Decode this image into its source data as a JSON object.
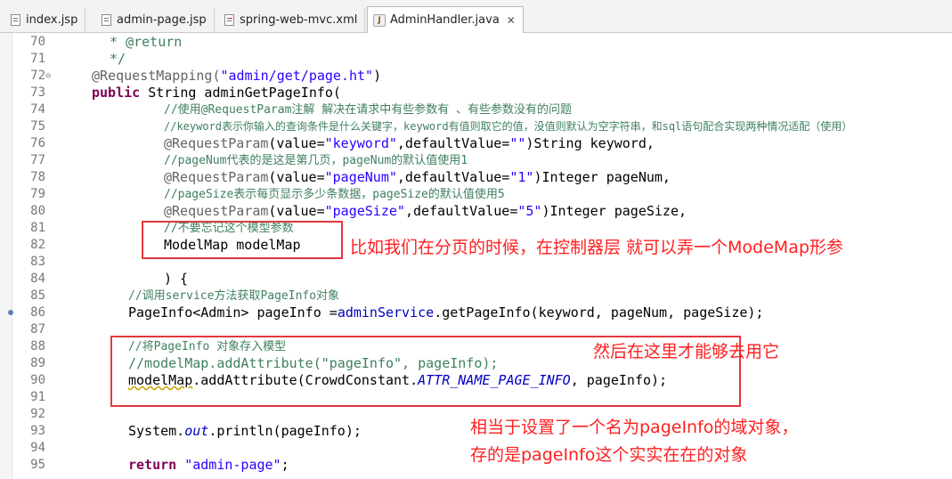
{
  "tabs": [
    {
      "name": "tab-index-jsp",
      "label": "index.jsp",
      "icon": "jsp-file-icon"
    },
    {
      "name": "tab-admin-page-jsp",
      "label": "admin-page.jsp",
      "icon": "jsp-file-icon"
    },
    {
      "name": "tab-spring-web-mvc-xml",
      "label": "spring-web-mvc.xml",
      "icon": "xml-file-icon"
    },
    {
      "name": "tab-admin-handler-java",
      "label": "AdminHandler.java",
      "icon": "java-file-icon",
      "active": true
    }
  ],
  "tab_close": "✕",
  "lines": {
    "l70": {
      "num": "70",
      "text": " * @return"
    },
    "l71": {
      "num": "71",
      "text": " */"
    },
    "l72": {
      "num": "72",
      "fold": "⊖",
      "ann": "@RequestMapping(",
      "str": "\"admin/get/page.ht\"",
      "end": ")"
    },
    "l73": {
      "num": "73",
      "k1": "public",
      "rest": " String adminGetPageInfo("
    },
    "l74": {
      "num": "74",
      "text": "//使用@RequestParam注解 解决在请求中有些参数有 、有些参数没有的问题"
    },
    "l75": {
      "num": "75",
      "text": "//keyword表示你输入的查询条件是什么关键字，keyword有值则取它的值，没值则默认为空字符串，和sql语句配合实现两种情况适配（使用）"
    },
    "l76": {
      "num": "76",
      "ann": "@RequestParam",
      "a": "(value=",
      "str": "\"keyword\"",
      "b": ",defaultValue=",
      "str2": "\"\"",
      "c": ")String keyword,"
    },
    "l77": {
      "num": "77",
      "text": "//pageNum代表的是这是第几页，pageNum的默认值使用1"
    },
    "l78": {
      "num": "78",
      "ann": "@RequestParam",
      "a": "(value=",
      "str": "\"pageNum\"",
      "b": ",defaultValue=",
      "str2": "\"1\"",
      "c": ")Integer pageNum,"
    },
    "l79": {
      "num": "79",
      "text": "//pageSize表示每页显示多少条数据，pageSize的默认值使用5"
    },
    "l80": {
      "num": "80",
      "ann": "@RequestParam",
      "a": "(value=",
      "str": "\"pageSize\"",
      "b": ",defaultValue=",
      "str2": "\"5\"",
      "c": ")Integer pageSize,"
    },
    "l81": {
      "num": "81",
      "text": "//不要忘记这个模型参数"
    },
    "l82": {
      "num": "82",
      "text": "ModelMap modelMap"
    },
    "l83": {
      "num": "83"
    },
    "l84": {
      "num": "84",
      "text": ") {"
    },
    "l85": {
      "num": "85",
      "text": "//调用service方法获取PageInfo对象"
    },
    "l86": {
      "num": "86",
      "a": "PageInfo<Admin> pageInfo =",
      "field": "adminService",
      "b": ".getPageInfo(keyword, pageNum, pageSize);"
    },
    "l87": {
      "num": "87"
    },
    "l88": {
      "num": "88",
      "text": "//将PageInfo 对象存入模型"
    },
    "l89": {
      "num": "89",
      "text": "//modelMap.addAttribute(\"pageInfo\", pageInfo);"
    },
    "l90": {
      "num": "90",
      "a": "modelMap",
      "b": ".addAttribute(CrowdConstant.",
      "static": "ATTR_NAME_PAGE_INFO",
      "c": ", pageInfo);"
    },
    "l91": {
      "num": "91"
    },
    "l92": {
      "num": "92"
    },
    "l93": {
      "num": "93",
      "a": "System.",
      "field": "out",
      "b": ".println(pageInfo);"
    },
    "l94": {
      "num": "94"
    },
    "l95": {
      "num": "95",
      "k1": "return",
      "str": " \"admin-page\"",
      "end": ";"
    }
  },
  "annotations": {
    "note1": "比如我们在分页的时候，在控制器层 就可以弄一个ModeMap形参",
    "note2": "然后在这里才能够去用它",
    "note3a": "相当于设置了一个名为pageInfo的域对象，",
    "note3b": "存的是pageInfo这个实实在在的对象"
  },
  "colors": {
    "accent": "#e0393e",
    "note": "#ff1f1f",
    "comment": "#3f7f5f",
    "keyword": "#7f0055",
    "string": "#2a00ff"
  }
}
